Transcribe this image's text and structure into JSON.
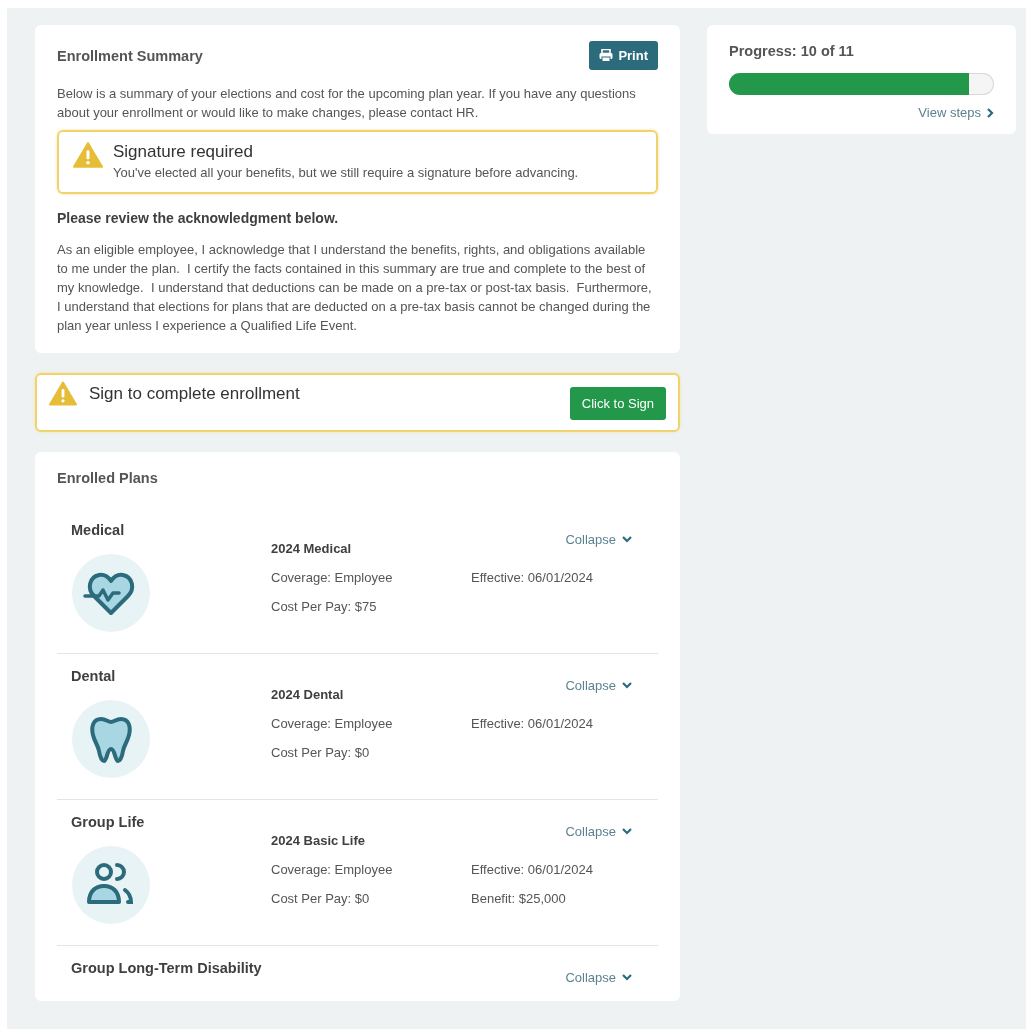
{
  "summary": {
    "title": "Enrollment Summary",
    "print_button": "Print",
    "intro": "Below is a summary of your elections and cost for the upcoming plan year. If you have any questions about your enrollment or would like to make changes, please contact HR.",
    "alert": {
      "title": "Signature required",
      "message": "You've elected all your benefits, but we still require a signature before advancing."
    },
    "review_heading": "Please review the acknowledgment below.",
    "acknowledgment": "As an eligible employee, I acknowledge that I understand the benefits, rights, and obligations available to me under the plan.  I certify the facts contained in this summary are true and complete to the best of my knowledge.  I understand that deductions can be made on a pre-tax or post-tax basis.  Furthermore, I understand that elections for plans that are deducted on a pre-tax basis cannot be changed during the plan year unless I experience a Qualified Life Event."
  },
  "sign_banner": {
    "message": "Sign to complete enrollment",
    "button": "Click to Sign"
  },
  "enrolled_plans": {
    "title": "Enrolled Plans",
    "plans": [
      {
        "category": "Medical",
        "kind": "medical",
        "toggle": "Collapse",
        "plan_name": "2024 Medical",
        "coverage": "Coverage: Employee",
        "effective": "Effective: 06/01/2024",
        "cost": "Cost Per Pay: $75"
      },
      {
        "category": "Dental",
        "kind": "dental",
        "toggle": "Collapse",
        "plan_name": "2024 Dental",
        "coverage": "Coverage: Employee",
        "effective": "Effective: 06/01/2024",
        "cost": "Cost Per Pay: $0"
      },
      {
        "category": "Group Life",
        "kind": "life",
        "toggle": "Collapse",
        "plan_name": "2024 Basic Life",
        "coverage": "Coverage: Employee",
        "effective": "Effective: 06/01/2024",
        "cost": "Cost Per Pay: $0",
        "benefit": "Benefit: $25,000"
      },
      {
        "category": "Group Long-Term Disability",
        "kind": "none",
        "toggle": "Collapse"
      }
    ]
  },
  "progress": {
    "label": "Progress: 10 of 11",
    "level": 0.905,
    "link": "View steps"
  }
}
